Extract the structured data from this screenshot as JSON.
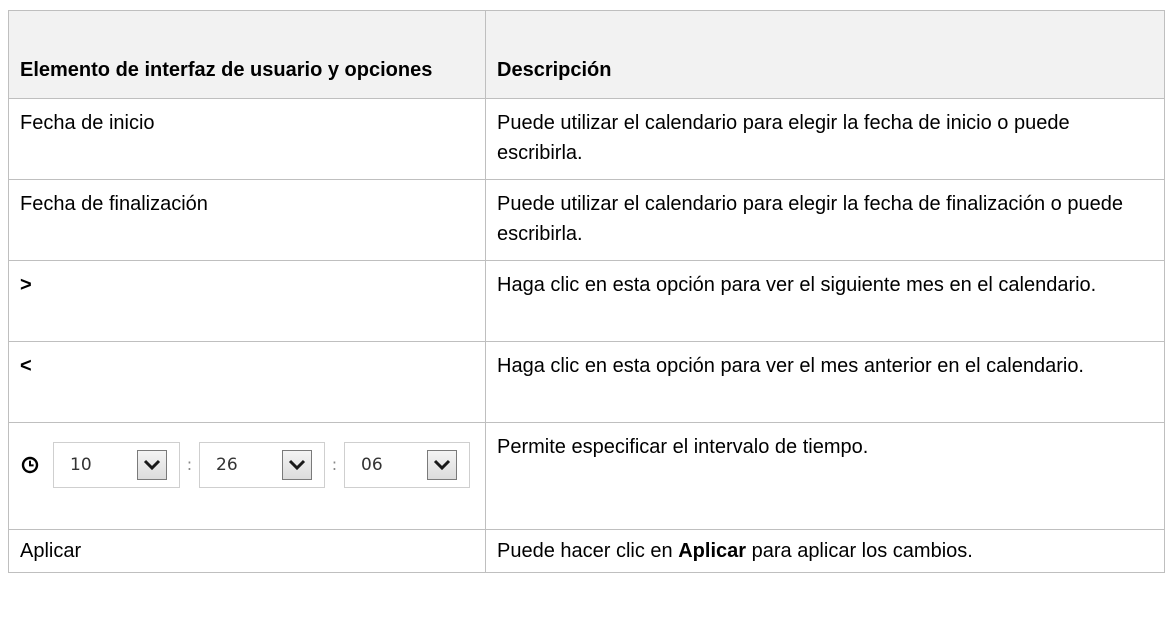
{
  "table": {
    "header": {
      "col1": "Elemento de interfaz de usuario y opciones",
      "col2": "Descripción"
    },
    "rows": [
      {
        "element": "Fecha de inicio",
        "description": "Puede utilizar el calendario para elegir la fecha de inicio o puede escribirla."
      },
      {
        "element": "Fecha de finalización",
        "description": "Puede utilizar el calendario para elegir la fecha de finalización o puede escribirla."
      },
      {
        "element": ">",
        "description": "Haga clic en esta opción para ver el siguiente mes en el calendario."
      },
      {
        "element": "<",
        "description": "Haga clic en esta opción para ver el mes anterior en el calendario."
      },
      {
        "time_widget": {
          "icon": "clock-icon",
          "hours": "10",
          "minutes": "26",
          "seconds": "06",
          "separator": ":"
        },
        "description": "Permite especificar el intervalo de tiempo."
      },
      {
        "element": "Aplicar",
        "description_before": "Puede hacer clic en ",
        "description_bold": "Aplicar",
        "description_after": " para aplicar los cambios."
      }
    ]
  },
  "colors": {
    "header_background": "#f2f2f2",
    "border": "#bfbfbf"
  }
}
